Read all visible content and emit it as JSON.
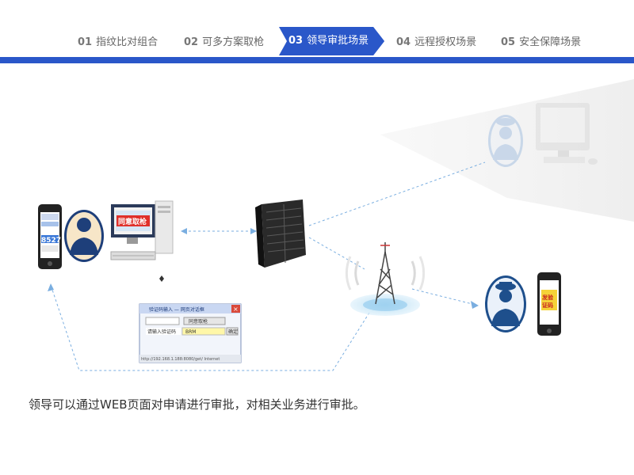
{
  "nav": {
    "tabs": [
      {
        "num": "01",
        "label": "指纹比对组合",
        "active": false
      },
      {
        "num": "02",
        "label": "可多方案取枪",
        "active": false
      },
      {
        "num": "03",
        "label": "领导审批场景",
        "active": true
      },
      {
        "num": "04",
        "label": "远程授权场景",
        "active": false
      },
      {
        "num": "05",
        "label": "安全保障场景",
        "active": false
      }
    ],
    "accent_color": "#2a57c9"
  },
  "diagram": {
    "phone_left_code": "8527",
    "monitor_text": "同意取枪",
    "phone_right_text": "发验证码",
    "dialog": {
      "title": "验证码输入 — 网页对话框",
      "value": "同意取枪",
      "field_label": "请输入验证码",
      "input_value": "BRM",
      "confirm_label": "确定",
      "status": "http://192.168.1.188:8080/get/  Internet"
    },
    "icons": [
      "smartphone-icon",
      "officer-avatar-icon",
      "desktop-computer-icon",
      "server-rack-icon",
      "radio-tower-icon",
      "remote-computer-icon"
    ]
  },
  "caption": "领导可以通过WEB页面对申请进行审批，对相关业务进行审批。"
}
